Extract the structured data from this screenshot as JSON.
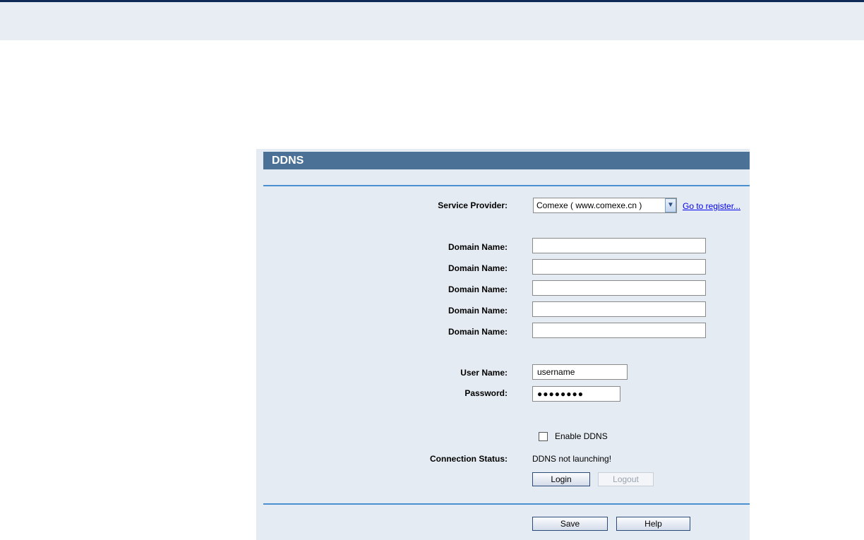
{
  "panel": {
    "title": "DDNS"
  },
  "service_provider": {
    "label": "Service Provider:",
    "selected": "Comexe ( www.comexe.cn )",
    "register_link": "Go to register..."
  },
  "domains": [
    {
      "label": "Domain Name:",
      "value": ""
    },
    {
      "label": "Domain Name:",
      "value": ""
    },
    {
      "label": "Domain Name:",
      "value": ""
    },
    {
      "label": "Domain Name:",
      "value": ""
    },
    {
      "label": "Domain Name:",
      "value": ""
    }
  ],
  "user_name": {
    "label": "User Name:",
    "value": "username"
  },
  "password": {
    "label": "Password:",
    "value": "●●●●●●●●"
  },
  "enable_ddns": {
    "label": "Enable DDNS",
    "checked": false
  },
  "connection_status": {
    "label": "Connection Status:",
    "value": "DDNS not launching!"
  },
  "buttons": {
    "login": "Login",
    "logout": "Logout",
    "save": "Save",
    "help": "Help"
  },
  "icons": {
    "dropdown": "chevron-down-icon"
  },
  "colors": {
    "header_bg": "#4b7196",
    "panel_bg": "#e5ebf2",
    "rule": "#4a8fd0",
    "link": "#0000ee",
    "topbar_border": "#0f2a55"
  }
}
